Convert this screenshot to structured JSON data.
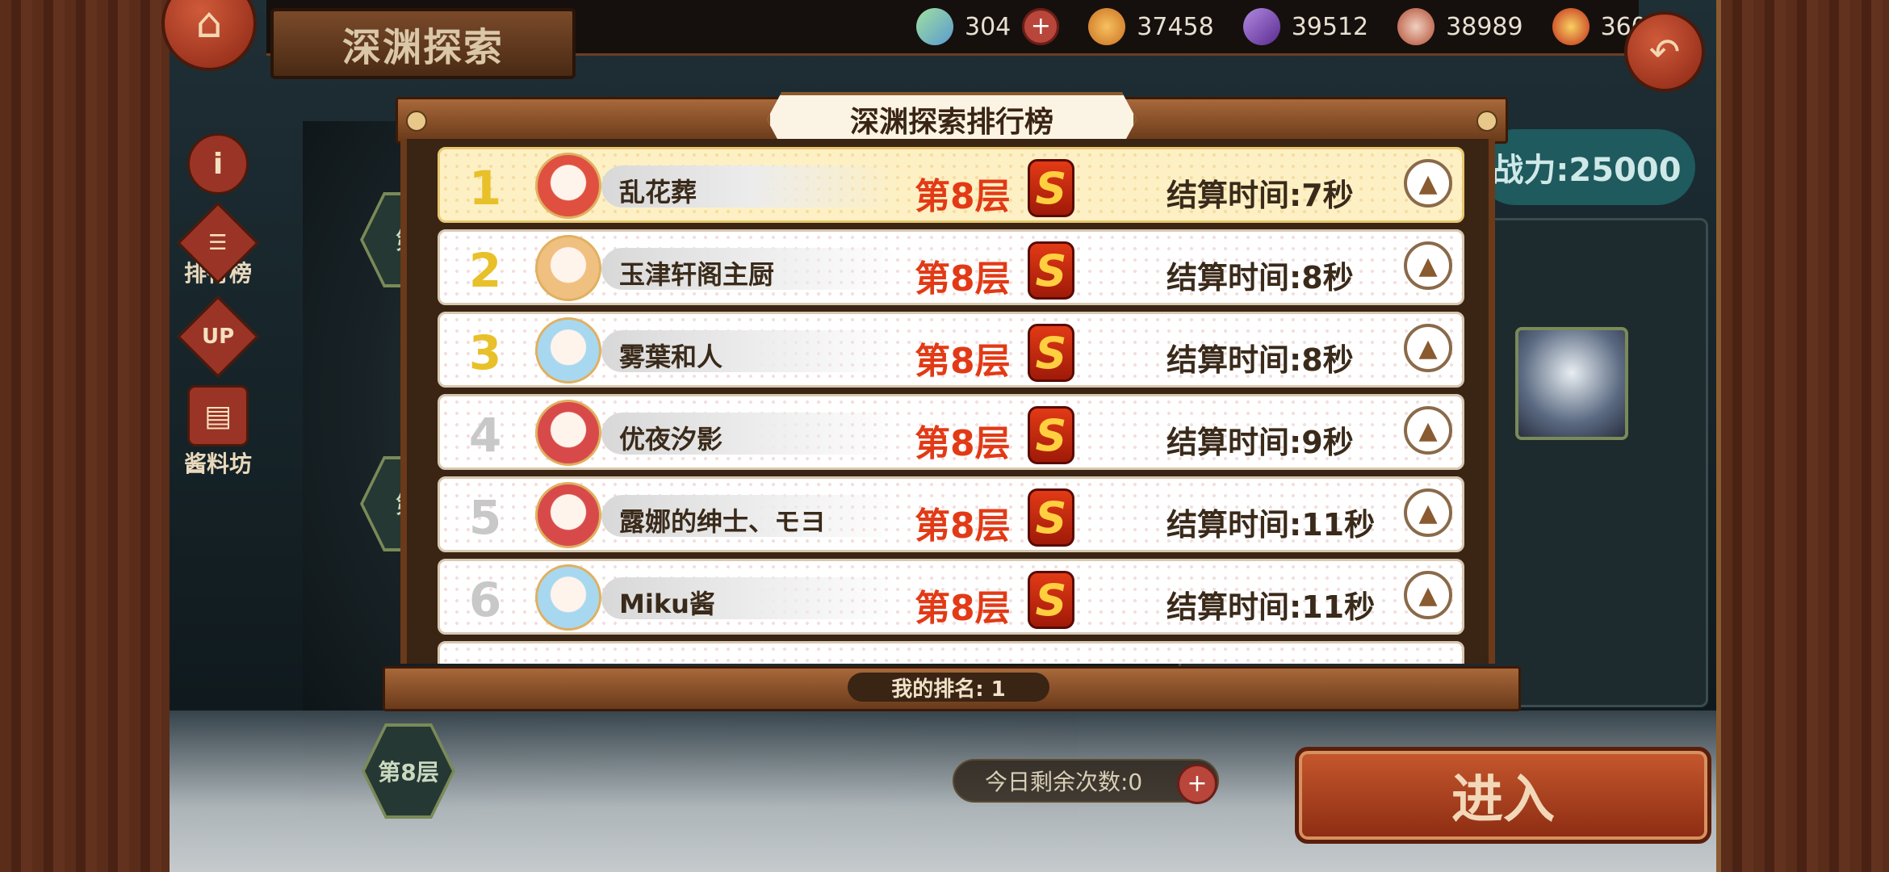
{
  "header": {
    "title": "深渊探索",
    "resources": [
      {
        "icon": "gem-icon",
        "value": "304",
        "color": "#8fd08a"
      },
      {
        "icon": "potion-icon",
        "value": "37458",
        "color": "#e8a040"
      },
      {
        "icon": "crystal-icon",
        "value": "39512",
        "color": "#7a4ab0"
      },
      {
        "icon": "meat-icon",
        "value": "38989",
        "color": "#c05a40"
      },
      {
        "icon": "pot-icon",
        "value": "36044",
        "color": "#c8402a"
      }
    ]
  },
  "side_menu": [
    {
      "icon": "info-icon",
      "label": ""
    },
    {
      "icon": "ranking-icon",
      "label": "排行榜"
    },
    {
      "icon": "upgrade-icon",
      "label": "UP"
    },
    {
      "icon": "workshop-icon",
      "label": "酱料坊"
    }
  ],
  "floors": {
    "hex_top": "第",
    "hex_mid": "第",
    "hex_bottom": "第8层"
  },
  "right_panel": {
    "power_label": "战力:25000",
    "remaining_label": "今日剩余次数:0",
    "enter_label": "进入"
  },
  "modal": {
    "title": "深渊探索排行榜",
    "my_rank_label": "我的排名: 1",
    "rows": [
      {
        "rank": "1",
        "name": "乱花葬",
        "floor": "第8层",
        "grade": "S",
        "time": "结算时间:7秒",
        "avatar_color": "#e05040"
      },
      {
        "rank": "2",
        "name": "玉津轩阁主厨",
        "floor": "第8层",
        "grade": "S",
        "time": "结算时间:8秒",
        "avatar_color": "#f0c080"
      },
      {
        "rank": "3",
        "name": "雾葉和人",
        "floor": "第8层",
        "grade": "S",
        "time": "结算时间:8秒",
        "avatar_color": "#a8d8f0"
      },
      {
        "rank": "4",
        "name": "优夜汐影",
        "floor": "第8层",
        "grade": "S",
        "time": "结算时间:9秒",
        "avatar_color": "#d84a4a"
      },
      {
        "rank": "5",
        "name": "露娜的绅士、モヨ",
        "floor": "第8层",
        "grade": "S",
        "time": "结算时间:11秒",
        "avatar_color": "#d84a4a"
      },
      {
        "rank": "6",
        "name": "Miku酱",
        "floor": "第8层",
        "grade": "S",
        "time": "结算时间:11秒",
        "avatar_color": "#a8d8f0"
      }
    ]
  }
}
